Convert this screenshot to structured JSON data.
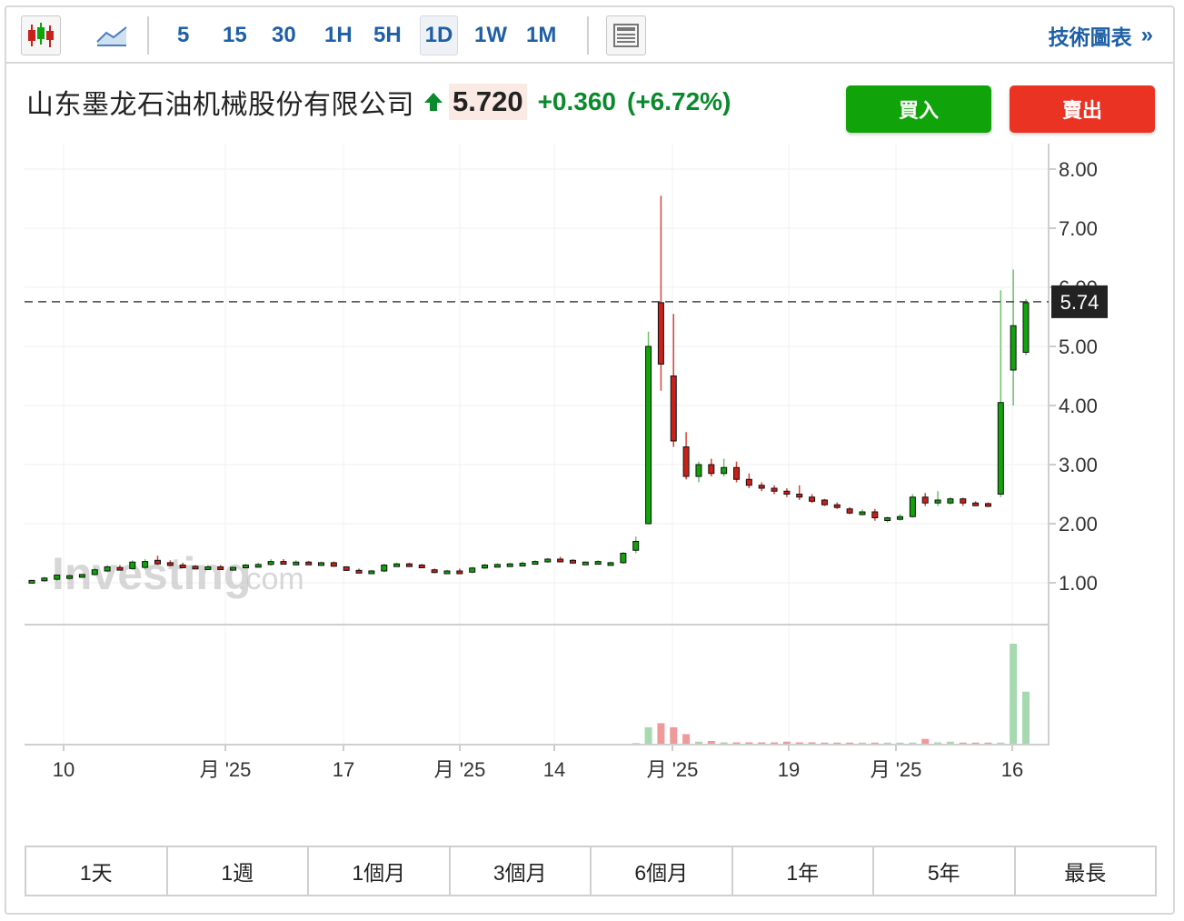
{
  "toolbar": {
    "intervals": [
      "5",
      "15",
      "30",
      "1H",
      "5H",
      "1D",
      "1W",
      "1M"
    ],
    "active_interval": "1D",
    "tech_label": "技術圖表",
    "tech_chevron": "»"
  },
  "quote": {
    "name": "山东墨龙石油机械股份有限公司",
    "price": "5.720",
    "change": "+0.360",
    "change_pct": "(+6.72%)",
    "direction": "up"
  },
  "actions": {
    "buy_label": "買入",
    "sell_label": "賣出"
  },
  "watermark": {
    "brand": "Investing",
    "suffix": ".com"
  },
  "colors": {
    "up": "#10a30a",
    "down": "#c9201a",
    "accent": "#1e5fa6",
    "buy": "#10a30a",
    "sell": "#ea3323"
  },
  "chart_data": {
    "type": "candlestick",
    "y_ticks": [
      "1.00",
      "2.00",
      "3.00",
      "4.00",
      "5.00",
      "6.00",
      "7.00",
      "8.00"
    ],
    "ylim": [
      0.5,
      8.2
    ],
    "x_ticks": [
      "10",
      "月 '25",
      "17",
      "月 '25",
      "14",
      "月 '25",
      "19",
      "月 '25",
      "16"
    ],
    "last_price_label": "5.74",
    "last_price": 5.74,
    "grid": true,
    "candles": [
      {
        "o": 1.02,
        "h": 1.05,
        "l": 1.0,
        "c": 1.04
      },
      {
        "o": 1.04,
        "h": 1.1,
        "l": 1.02,
        "c": 1.08
      },
      {
        "o": 1.06,
        "h": 1.14,
        "l": 1.03,
        "c": 1.13
      },
      {
        "o": 1.08,
        "h": 1.14,
        "l": 1.05,
        "c": 1.12
      },
      {
        "o": 1.1,
        "h": 1.15,
        "l": 1.08,
        "c": 1.14
      },
      {
        "o": 1.14,
        "h": 1.25,
        "l": 1.12,
        "c": 1.22
      },
      {
        "o": 1.2,
        "h": 1.3,
        "l": 1.18,
        "c": 1.27
      },
      {
        "o": 1.26,
        "h": 1.3,
        "l": 1.22,
        "c": 1.25
      },
      {
        "o": 1.24,
        "h": 1.38,
        "l": 1.22,
        "c": 1.35
      },
      {
        "o": 1.26,
        "h": 1.4,
        "l": 1.22,
        "c": 1.36
      },
      {
        "o": 1.38,
        "h": 1.46,
        "l": 1.3,
        "c": 1.32
      },
      {
        "o": 1.34,
        "h": 1.38,
        "l": 1.28,
        "c": 1.3
      },
      {
        "o": 1.3,
        "h": 1.34,
        "l": 1.26,
        "c": 1.28
      },
      {
        "o": 1.28,
        "h": 1.3,
        "l": 1.25,
        "c": 1.26
      },
      {
        "o": 1.26,
        "h": 1.3,
        "l": 1.24,
        "c": 1.27
      },
      {
        "o": 1.27,
        "h": 1.3,
        "l": 1.24,
        "c": 1.25
      },
      {
        "o": 1.25,
        "h": 1.28,
        "l": 1.23,
        "c": 1.26
      },
      {
        "o": 1.26,
        "h": 1.32,
        "l": 1.24,
        "c": 1.3
      },
      {
        "o": 1.3,
        "h": 1.34,
        "l": 1.27,
        "c": 1.31
      },
      {
        "o": 1.31,
        "h": 1.4,
        "l": 1.29,
        "c": 1.36
      },
      {
        "o": 1.36,
        "h": 1.4,
        "l": 1.32,
        "c": 1.34
      },
      {
        "o": 1.34,
        "h": 1.38,
        "l": 1.31,
        "c": 1.35
      },
      {
        "o": 1.35,
        "h": 1.37,
        "l": 1.31,
        "c": 1.33
      },
      {
        "o": 1.33,
        "h": 1.36,
        "l": 1.29,
        "c": 1.34
      },
      {
        "o": 1.34,
        "h": 1.36,
        "l": 1.27,
        "c": 1.28
      },
      {
        "o": 1.27,
        "h": 1.28,
        "l": 1.2,
        "c": 1.21
      },
      {
        "o": 1.21,
        "h": 1.24,
        "l": 1.18,
        "c": 1.19
      },
      {
        "o": 1.19,
        "h": 1.22,
        "l": 1.16,
        "c": 1.2
      },
      {
        "o": 1.2,
        "h": 1.32,
        "l": 1.18,
        "c": 1.3
      },
      {
        "o": 1.3,
        "h": 1.34,
        "l": 1.27,
        "c": 1.32
      },
      {
        "o": 1.32,
        "h": 1.34,
        "l": 1.28,
        "c": 1.3
      },
      {
        "o": 1.3,
        "h": 1.32,
        "l": 1.26,
        "c": 1.29
      },
      {
        "o": 1.22,
        "h": 1.24,
        "l": 1.16,
        "c": 1.18
      },
      {
        "o": 1.18,
        "h": 1.22,
        "l": 1.15,
        "c": 1.2
      },
      {
        "o": 1.2,
        "h": 1.24,
        "l": 1.16,
        "c": 1.18
      },
      {
        "o": 1.18,
        "h": 1.27,
        "l": 1.16,
        "c": 1.25
      },
      {
        "o": 1.25,
        "h": 1.32,
        "l": 1.23,
        "c": 1.3
      },
      {
        "o": 1.3,
        "h": 1.33,
        "l": 1.27,
        "c": 1.31
      },
      {
        "o": 1.31,
        "h": 1.34,
        "l": 1.28,
        "c": 1.32
      },
      {
        "o": 1.32,
        "h": 1.36,
        "l": 1.29,
        "c": 1.33
      },
      {
        "o": 1.33,
        "h": 1.38,
        "l": 1.31,
        "c": 1.36
      },
      {
        "o": 1.36,
        "h": 1.42,
        "l": 1.34,
        "c": 1.4
      },
      {
        "o": 1.4,
        "h": 1.44,
        "l": 1.36,
        "c": 1.38
      },
      {
        "o": 1.38,
        "h": 1.4,
        "l": 1.32,
        "c": 1.34
      },
      {
        "o": 1.34,
        "h": 1.36,
        "l": 1.31,
        "c": 1.35
      },
      {
        "o": 1.35,
        "h": 1.38,
        "l": 1.32,
        "c": 1.36
      },
      {
        "o": 1.32,
        "h": 1.36,
        "l": 1.3,
        "c": 1.34
      },
      {
        "o": 1.34,
        "h": 1.52,
        "l": 1.32,
        "c": 1.5
      },
      {
        "o": 1.55,
        "h": 1.78,
        "l": 1.5,
        "c": 1.7
      },
      {
        "o": 2.0,
        "h": 5.25,
        "l": 2.0,
        "c": 5.0
      },
      {
        "o": 5.74,
        "h": 7.55,
        "l": 4.25,
        "c": 4.7
      },
      {
        "o": 4.5,
        "h": 5.55,
        "l": 3.3,
        "c": 3.4
      },
      {
        "o": 3.3,
        "h": 3.55,
        "l": 2.75,
        "c": 2.8
      },
      {
        "o": 2.8,
        "h": 3.05,
        "l": 2.7,
        "c": 3.0
      },
      {
        "o": 3.0,
        "h": 3.1,
        "l": 2.8,
        "c": 2.85
      },
      {
        "o": 2.85,
        "h": 3.1,
        "l": 2.8,
        "c": 2.95
      },
      {
        "o": 2.95,
        "h": 3.05,
        "l": 2.7,
        "c": 2.75
      },
      {
        "o": 2.75,
        "h": 2.85,
        "l": 2.6,
        "c": 2.65
      },
      {
        "o": 2.65,
        "h": 2.7,
        "l": 2.55,
        "c": 2.6
      },
      {
        "o": 2.6,
        "h": 2.65,
        "l": 2.5,
        "c": 2.55
      },
      {
        "o": 2.55,
        "h": 2.6,
        "l": 2.45,
        "c": 2.5
      },
      {
        "o": 2.5,
        "h": 2.65,
        "l": 2.4,
        "c": 2.45
      },
      {
        "o": 2.45,
        "h": 2.5,
        "l": 2.35,
        "c": 2.38
      },
      {
        "o": 2.4,
        "h": 2.42,
        "l": 2.3,
        "c": 2.32
      },
      {
        "o": 2.32,
        "h": 2.36,
        "l": 2.25,
        "c": 2.28
      },
      {
        "o": 2.25,
        "h": 2.28,
        "l": 2.16,
        "c": 2.18
      },
      {
        "o": 2.18,
        "h": 2.24,
        "l": 2.14,
        "c": 2.2
      },
      {
        "o": 2.2,
        "h": 2.25,
        "l": 2.05,
        "c": 2.1
      },
      {
        "o": 2.08,
        "h": 2.12,
        "l": 2.02,
        "c": 2.1
      },
      {
        "o": 2.1,
        "h": 2.16,
        "l": 2.05,
        "c": 2.12
      },
      {
        "o": 2.12,
        "h": 2.5,
        "l": 2.1,
        "c": 2.45
      },
      {
        "o": 2.45,
        "h": 2.52,
        "l": 2.3,
        "c": 2.35
      },
      {
        "o": 2.35,
        "h": 2.55,
        "l": 2.3,
        "c": 2.4
      },
      {
        "o": 2.35,
        "h": 2.45,
        "l": 2.32,
        "c": 2.42
      },
      {
        "o": 2.42,
        "h": 2.44,
        "l": 2.3,
        "c": 2.35
      },
      {
        "o": 2.35,
        "h": 2.38,
        "l": 2.3,
        "c": 2.34
      },
      {
        "o": 2.34,
        "h": 2.36,
        "l": 2.28,
        "c": 2.3
      },
      {
        "o": 2.5,
        "h": 5.95,
        "l": 2.45,
        "c": 4.05
      },
      {
        "o": 4.6,
        "h": 6.3,
        "l": 4.0,
        "c": 5.35
      },
      {
        "o": 4.9,
        "h": 5.8,
        "l": 4.85,
        "c": 5.74
      }
    ],
    "volume": [
      0,
      0,
      0,
      0,
      0,
      0,
      0,
      0,
      0,
      0,
      0,
      0,
      0,
      0,
      0,
      0,
      0,
      0,
      0,
      0,
      0,
      0,
      0,
      0,
      0,
      0,
      0,
      0,
      0,
      0,
      0,
      0,
      0,
      0,
      0,
      0,
      0,
      0,
      0,
      0,
      0,
      0,
      0,
      0,
      0,
      0,
      0,
      0,
      0.5,
      12,
      15,
      12,
      7,
      1.5,
      2,
      1,
      1,
      1,
      1,
      1,
      1.5,
      1,
      1,
      0.8,
      0.8,
      0.8,
      0.8,
      0.8,
      0.8,
      0.8,
      0.8,
      3.5,
      1,
      1.5,
      0.8,
      0.8,
      0.8,
      0.8,
      73,
      38,
      0
    ]
  },
  "ranges": [
    "1天",
    "1週",
    "1個月",
    "3個月",
    "6個月",
    "1年",
    "5年",
    "最長"
  ]
}
